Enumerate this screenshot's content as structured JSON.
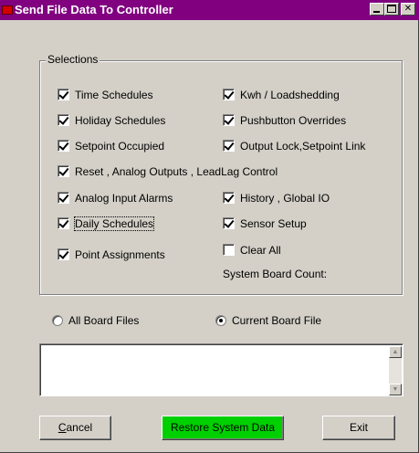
{
  "window": {
    "title": "Send File Data To Controller"
  },
  "selections": {
    "legend": "Selections",
    "checkboxes": [
      {
        "label": "Time Schedules",
        "checked": true
      },
      {
        "label": "Holiday Schedules",
        "checked": true
      },
      {
        "label": "Setpoint Occupied",
        "checked": true
      },
      {
        "label": "Reset , Analog Outputs , LeadLag Control",
        "checked": true
      },
      {
        "label": "Analog Input  Alarms",
        "checked": true
      },
      {
        "label": "Daily Schedules",
        "checked": true
      },
      {
        "label": "Point Assignments",
        "checked": true
      },
      {
        "label": "Kwh / Loadshedding",
        "checked": true
      },
      {
        "label": "Pushbutton Overrides",
        "checked": true
      },
      {
        "label": "Output Lock,Setpoint Link",
        "checked": true
      },
      {
        "label": "History , Global IO",
        "checked": true
      },
      {
        "label": "Sensor Setup",
        "checked": true
      },
      {
        "label": "Clear All",
        "checked": false
      }
    ],
    "system_board_count_label": "System Board Count:"
  },
  "file_mode": {
    "options": [
      {
        "label": "All Board Files",
        "selected": false
      },
      {
        "label": "Current Board File",
        "selected": true
      }
    ]
  },
  "log": {
    "value": ""
  },
  "buttons": {
    "cancel": "Cancel",
    "restore": "Restore System Data",
    "exit": "Exit"
  },
  "colors": {
    "titlebar": "#800080",
    "restore_button": "#00d000",
    "face": "#d4d0c8"
  },
  "icons": {
    "app": "app-icon",
    "minimize": "minimize-icon",
    "maximize": "maximize-icon",
    "close": "close-icon",
    "scroll_up": "scroll-up-arrow-icon",
    "scroll_down": "scroll-down-arrow-icon"
  }
}
